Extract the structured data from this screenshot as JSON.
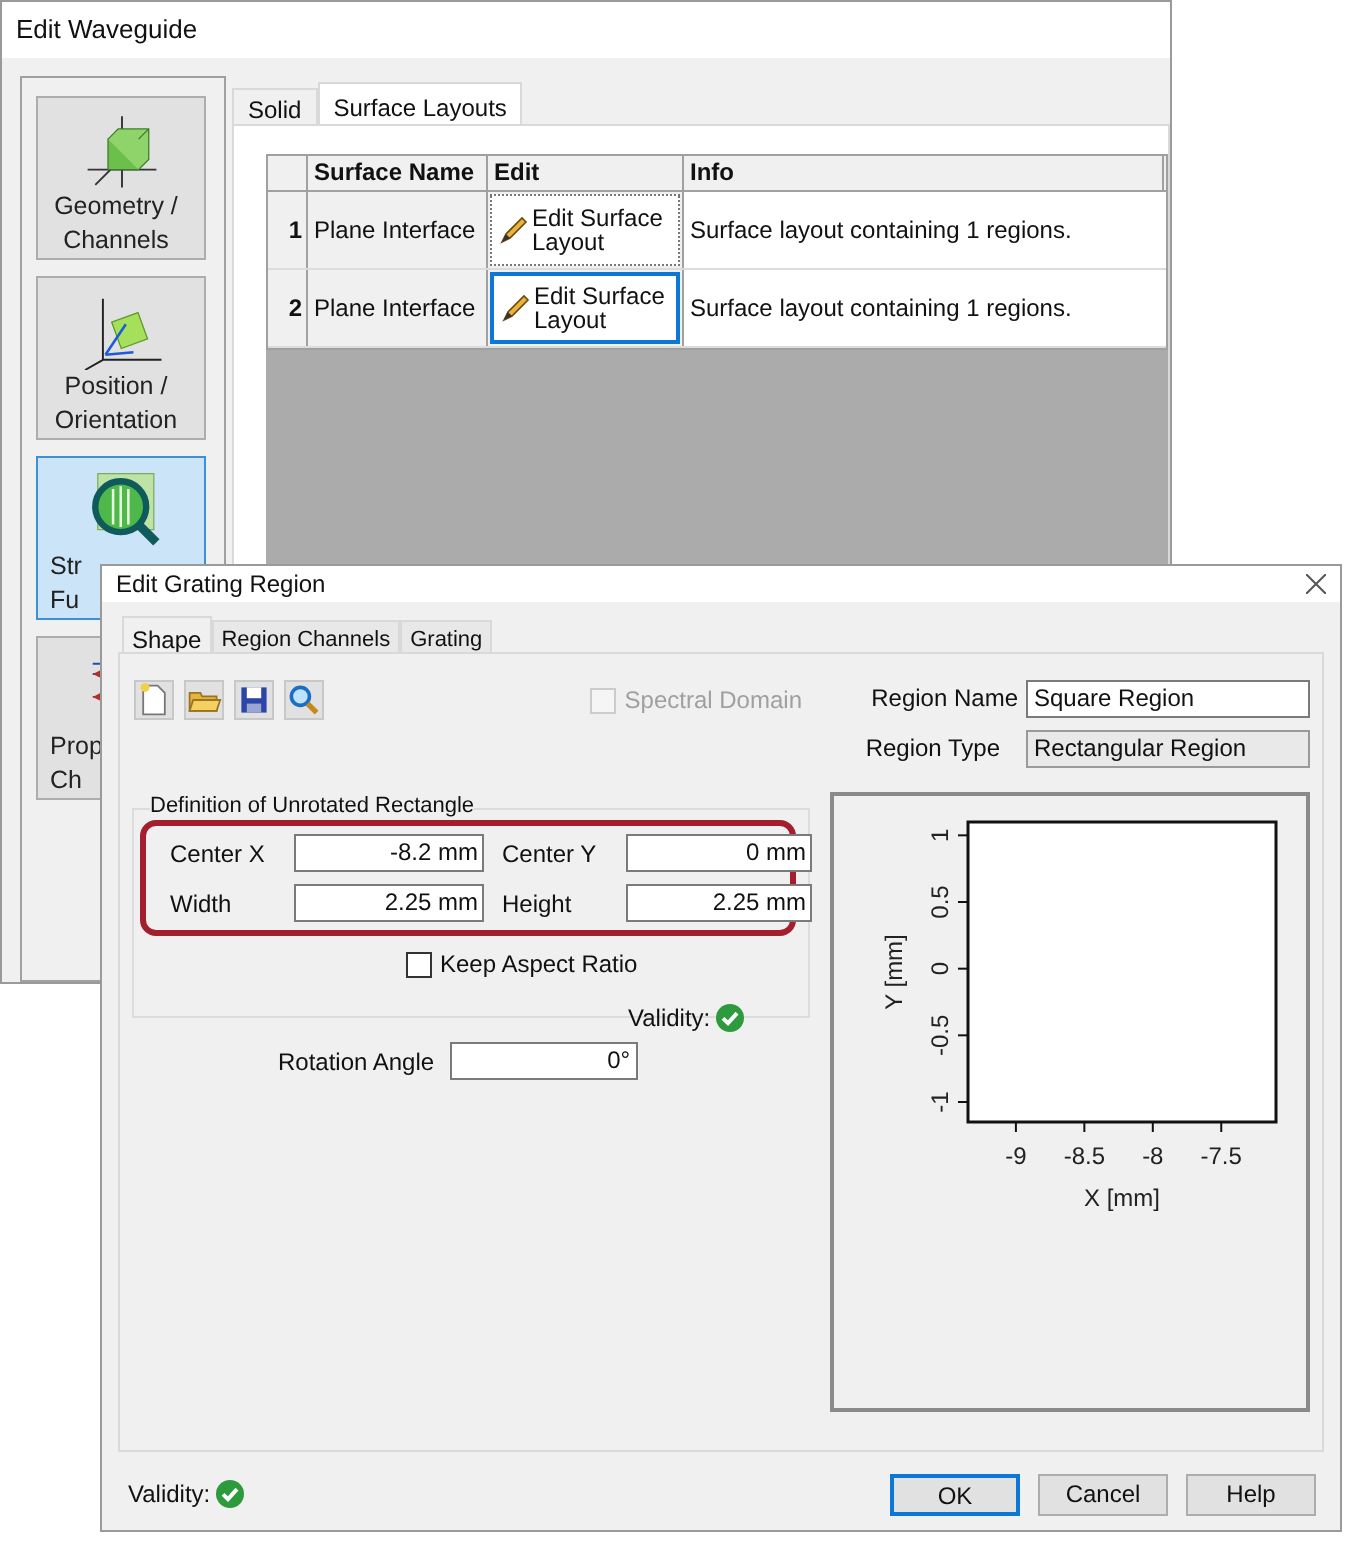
{
  "back_window": {
    "title": "Edit Waveguide",
    "sidebar": {
      "items": [
        {
          "label": "Geometry /\nChannels",
          "kind": "geometry",
          "selected": false
        },
        {
          "label": "Position /\nOrientation",
          "kind": "position",
          "selected": false
        },
        {
          "label": "Str\nFu",
          "kind": "structure",
          "selected": true
        },
        {
          "label": "Prop\nCh",
          "kind": "propagation",
          "selected": false
        }
      ]
    },
    "tabs": [
      {
        "label": "Solid",
        "selected": false
      },
      {
        "label": "Surface Layouts",
        "selected": true
      }
    ],
    "table": {
      "columns": [
        "Surface Name",
        "Edit",
        "Info"
      ],
      "rows": [
        {
          "number": "1",
          "surface_name": "Plane Interface",
          "edit": "Edit Surface\nLayout",
          "info": "Surface layout containing 1 regions.",
          "focused": false
        },
        {
          "number": "2",
          "surface_name": "Plane Interface",
          "edit": "Edit Surface\nLayout",
          "info": "Surface layout containing 1 regions.",
          "focused": true
        }
      ]
    }
  },
  "dialog": {
    "title": "Edit Grating Region",
    "tabs": [
      {
        "label": "Shape",
        "selected": true
      },
      {
        "label": "Region Channels",
        "selected": false
      },
      {
        "label": "Grating",
        "selected": false
      }
    ],
    "spectral_domain": {
      "label": "Spectral Domain",
      "checked": false,
      "disabled": true
    },
    "region_name": {
      "label": "Region Name",
      "value": "Square Region",
      "disabled": false
    },
    "region_type": {
      "label": "Region Type",
      "value": "Rectangular Region",
      "disabled": true
    },
    "rectangle": {
      "title": "Definition of Unrotated Rectangle",
      "highlighted": true,
      "fields": [
        {
          "label": "Center X",
          "value": "-8.2 mm"
        },
        {
          "label": "Center Y",
          "value": "0 mm"
        },
        {
          "label": "Width",
          "value": "2.25 mm"
        },
        {
          "label": "Height",
          "value": "2.25 mm"
        }
      ],
      "keep_aspect_ratio": {
        "label": "Keep Aspect Ratio",
        "checked": false
      },
      "validity": {
        "label": "Validity:",
        "valid": true
      }
    },
    "rotation": {
      "label": "Rotation Angle",
      "value": "0°"
    },
    "plot": {
      "chart_data": {
        "type": "scatter",
        "xlabel": "X [mm]",
        "ylabel": "Y [mm]",
        "xlim": [
          -9.35,
          -7.1
        ],
        "ylim": [
          -1.15,
          1.1
        ],
        "xticks": [
          -9,
          -8.5,
          -8,
          -7.5
        ],
        "yticks": [
          -1,
          -0.5,
          0,
          0.5,
          1
        ]
      }
    },
    "validity": {
      "label": "Validity:",
      "valid": true
    },
    "buttons": [
      {
        "label": "OK",
        "default": true
      },
      {
        "label": "Cancel",
        "default": false
      },
      {
        "label": "Help",
        "default": false
      }
    ]
  }
}
